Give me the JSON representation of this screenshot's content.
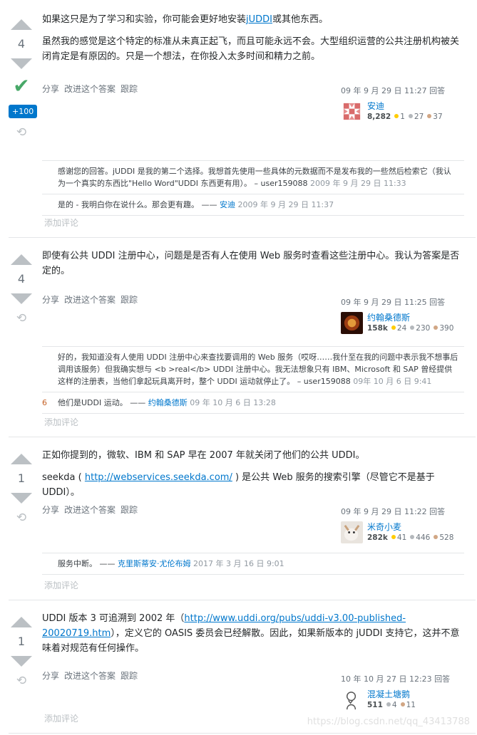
{
  "common": {
    "share": "分享",
    "improve": "改进这个答案",
    "follow": "跟踪",
    "add_comment": "添加评论"
  },
  "answers": [
    {
      "score": "4",
      "accepted": true,
      "bounty": "+100",
      "paragraphs": [
        {
          "before": "如果这只是为了学习和实验，你可能会更好地安装",
          "link": "jUDDI",
          "after": "或其他东西。"
        },
        {
          "before": "虽然我的感觉是这个特定的标准从未真正起飞，而且可能永远不会。大型组织运营的公共注册机构被关闭肯定是有原因的。只是一个想法，在你投入太多时间和精力之前。",
          "link": "",
          "after": ""
        }
      ],
      "answered": "09 年 9 月 29 日 11:27 回答",
      "user": {
        "name": "安迪",
        "rep": "8,282",
        "gold": "1",
        "silver": "27",
        "bronze": "37"
      },
      "comments": [
        {
          "score": "",
          "text": "感谢您的回答。jUDDI 是我的第二个选择。我想首先使用一些具体的元数据而不是发布我的一些然后检索它（我认为一个真实的东西比\"Hello Word\"UDDI 东西更有用）。 – ",
          "user": "user159088",
          "date": "2009 年 9 月 29 日 11:33",
          "user_link": false
        },
        {
          "score": "",
          "text": "是的 - 我明白你在说什么。那会更有趣。 —— ",
          "user": "安迪",
          "date": "2009 年 9 月 29 日 11:37",
          "user_link": true
        }
      ]
    },
    {
      "score": "4",
      "accepted": false,
      "bounty": "",
      "paragraphs": [
        {
          "before": "即使有公共 UDDI 注册中心，问题是是否有人在使用 Web 服务时查看这些注册中心。我认为答案是否定的。",
          "link": "",
          "after": ""
        }
      ],
      "answered": "09 年 9 月 29 日 11:25 回答",
      "user": {
        "name": "约翰桑德斯",
        "rep": "158k",
        "gold": "24",
        "silver": "230",
        "bronze": "390"
      },
      "comments": [
        {
          "score": "",
          "text": "好的，我知道没有人使用 UDDI 注册中心来查找要调用的 Web 服务（哎呀……我什至在我的问题中表示我不想事后调用该服务）但我确实想与 <b >real</b> UDDI 注册中心。我无法想象只有 IBM、Microsoft 和 SAP 曾经提供这样的注册表，当他们拿起玩具离开时，整个 UDDI 运动就停止了。 – ",
          "user": "user159088",
          "date": "09年 10 月 6 日 9:41",
          "user_link": false
        },
        {
          "score": "6",
          "text": "他们是UDDI 运动。 —— ",
          "user": "约翰桑德斯",
          "date": "09 年 10 月 6 日 13:28",
          "user_link": true
        }
      ]
    },
    {
      "score": "1",
      "accepted": false,
      "bounty": "",
      "paragraphs": [
        {
          "before": "正如你提到的，微软、IBM 和 SAP 早在 2007 年就关闭了他们的公共 UDDI。",
          "link": "",
          "after": ""
        },
        {
          "before": "seekda ( ",
          "link": "http://webservices.seekda.com/",
          "after": " ) 是公共 Web 服务的搜索引擎（尽管它不是基于 UDDI）。"
        }
      ],
      "answered": "09 年 9 月 29 日 11:22 回答",
      "user": {
        "name": "米奇小麦",
        "rep": "282k",
        "gold": "41",
        "silver": "446",
        "bronze": "528"
      },
      "comments": [
        {
          "score": "",
          "text": "服务中断。 —— ",
          "user": "克里斯蒂安·尤伦布姆",
          "date": "2017 年 3 月 16 日 9:01",
          "user_link": true
        }
      ]
    },
    {
      "score": "1",
      "accepted": false,
      "bounty": "",
      "paragraphs": [
        {
          "before": "UDDI 版本 3 可追溯到 2002 年（",
          "link": "http://www.uddi.org/pubs/uddi-v3.00-published-20020719.htm",
          "after": "），定义它的 OASIS 委员会已经解散。因此，如果新版本的 jUDDI 支持它，这并不意味着对规范有任何操作。"
        }
      ],
      "answered": "10 年 10 月 27 日 12:23 回答",
      "user": {
        "name": "混凝土塘鹅",
        "rep": "511",
        "gold": "",
        "silver": "4",
        "bronze": "11"
      },
      "comments": []
    }
  ],
  "watermark": "https://blog.csdn.net/qq_43413788"
}
